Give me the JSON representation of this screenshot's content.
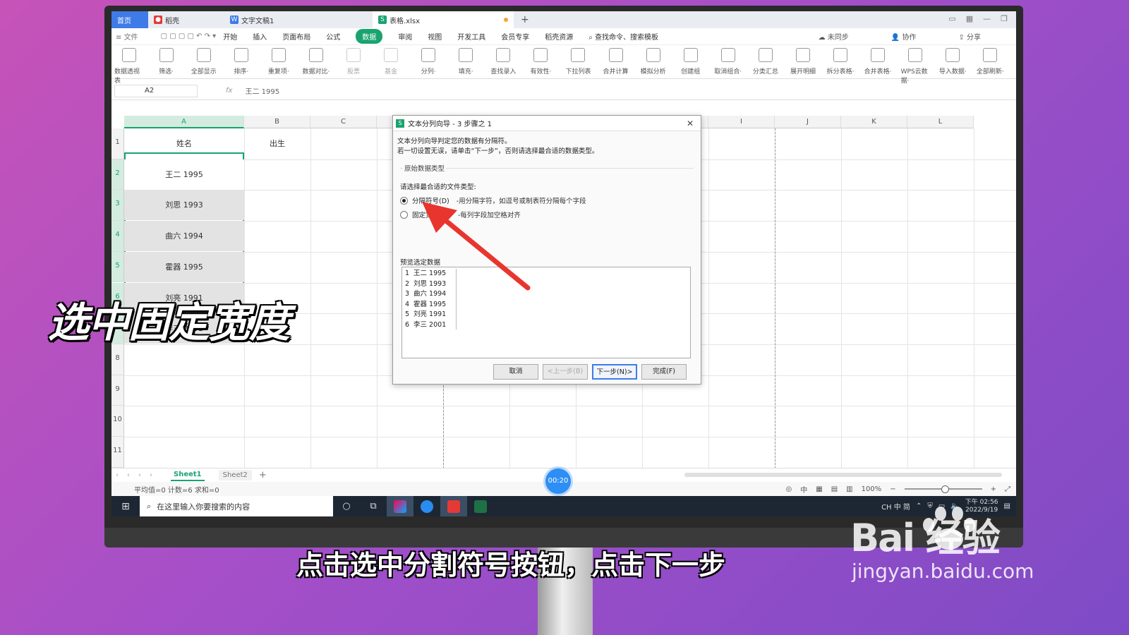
{
  "tabs": {
    "home": "首页",
    "wps": "稻壳",
    "doc": "文字文稿1",
    "sheet": "表格.xlsx",
    "plus": "+"
  },
  "menu": {
    "file": "文件",
    "items": [
      "开始",
      "插入",
      "页面布局",
      "公式",
      "数据",
      "审阅",
      "视图",
      "开发工具",
      "会员专享",
      "稻壳资源"
    ],
    "active": "数据",
    "search": "查找命令、搜索模板",
    "sync": "未同步",
    "collab": "协作",
    "share": "分享"
  },
  "ribbon": {
    "buttons": [
      "数据透视表",
      "筛选·",
      "全部显示",
      "排序·",
      "重复项·",
      "数据对比·",
      "股票",
      "基金",
      "分列·",
      "填充·",
      "查找录入",
      "有效性·",
      "下拉列表",
      "合并计算",
      "模拟分析",
      "创建组",
      "取消组合·",
      "分类汇总",
      "展开明细",
      "拆分表格·",
      "合并表格·",
      "WPS云数据·",
      "导入数据·",
      "全部刷新·"
    ]
  },
  "formula": {
    "namebox": "A2",
    "fx": "fx",
    "value": "王二   1995"
  },
  "grid": {
    "columns": [
      "A",
      "B",
      "C",
      "D",
      "E",
      "F",
      "G",
      "H",
      "I",
      "J",
      "K",
      "L"
    ],
    "rows": [
      "1",
      "2",
      "3",
      "4",
      "5",
      "6",
      "7",
      "8",
      "9",
      "10",
      "11"
    ],
    "header_a1": "姓名",
    "header_b1": "出生",
    "cells": [
      "王二   1995",
      "刘思   1993",
      "曲六   1994",
      "霍器   1995",
      "刘亮   1991",
      "李三   2001"
    ]
  },
  "sheets": {
    "sheet1": "Sheet1",
    "sheet2": "Sheet2",
    "add": "+"
  },
  "status": {
    "stats": "平均值=0  计数=6  求和=0",
    "zoom": "100%",
    "timer": "00:20"
  },
  "taskbar": {
    "search": "在这里输入你要搜索的内容",
    "tray": "CH 中 简",
    "time": "下午 02:56",
    "date": "2022/9/19"
  },
  "dialog": {
    "title": "文本分列向导 - 3 步骤之 1",
    "info1": "文本分列向导判定您的数据有分隔符。",
    "info2": "若一切设置无误，请单击“下一步”，否则请选择最合适的数据类型。",
    "group_title": "原始数据类型",
    "prompt": "请选择最合适的文件类型:",
    "option1": "分隔符号(D)",
    "option1_desc": "-用分隔字符，如逗号或制表符分隔每个字段",
    "option2": "固定宽度(W)",
    "option2_desc": "-每列字段加空格对齐",
    "preview_label": "预览选定数据",
    "preview_rows": [
      {
        "n": "1",
        "text": "王二 1995"
      },
      {
        "n": "2",
        "text": "刘思 1993"
      },
      {
        "n": "3",
        "text": "曲六 1994"
      },
      {
        "n": "4",
        "text": "霍器 1995"
      },
      {
        "n": "5",
        "text": "刘亮 1991"
      },
      {
        "n": "6",
        "text": "李三 2001"
      }
    ],
    "btn_cancel": "取消",
    "btn_back": "<上一步(B)",
    "btn_next": "下一步(N)>",
    "btn_finish": "完成(F)"
  },
  "overlay": {
    "caption": "选中固定宽度",
    "subtitle": "点击选中分割符号按钮，点击下一步",
    "watermark_logo": "Bai 经验",
    "watermark_url": "jingyan.baidu.com"
  },
  "colors": {
    "accent": "#1aa36f",
    "arrow": "#e8352e",
    "primary_blue": "#3f7be8"
  }
}
